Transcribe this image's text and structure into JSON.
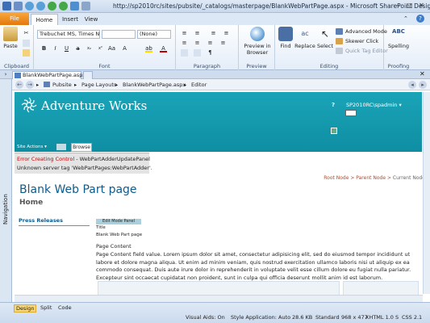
{
  "window": {
    "title": "http://sp2010rc/sites/pubsite/_catalogs/masterpage/BlankWebPartPage.aspx - Microsoft SharePoint Designer",
    "controls": [
      "–",
      "□",
      "✕"
    ]
  },
  "ribbon": {
    "tabs": {
      "file": "File",
      "home": "Home",
      "insert": "Insert",
      "view": "View"
    },
    "clipboard": {
      "label": "Clipboard",
      "paste": "Paste"
    },
    "font": {
      "label": "Font",
      "family": "Trebuchet MS, Times Ne",
      "size": "",
      "style": "(None)"
    },
    "paragraph": {
      "label": "Paragraph"
    },
    "preview": {
      "label": "Preview",
      "preview_in_browser": "Preview in Browser"
    },
    "editing": {
      "label": "Editing",
      "find": "Find",
      "replace": "Replace",
      "select": "Select",
      "advanced_mode": "Advanced Mode",
      "skewer_click": "Skewer Click",
      "quick_tag_editor": "Quick Tag Editor"
    },
    "proofing": {
      "label": "Proofing",
      "spelling": "Spelling"
    }
  },
  "document": {
    "tab_label": "BlankWebPartPage.aspx",
    "navigation_label": "Navigation",
    "breadcrumb": [
      "Pubsite",
      "Page Layouts",
      "BlankWebPartPage.aspx",
      "Editor"
    ]
  },
  "page": {
    "site_title": "Adventure Works",
    "user": "SP2010RC\\spadmin",
    "help": "?",
    "site_actions": "Site Actions",
    "browse_tab": "Browse",
    "error_title": "Error Creating Control",
    "error_title_rest": " - WebPartAdderUpdatePanel",
    "error_message": "Unknown server tag 'WebPartPages:WebPartAdder'.",
    "crumbs": {
      "root": "Root Node",
      "parent": "Parent Node",
      "current": "Current Node",
      "sep": " > "
    },
    "title": "Blank Web Part page",
    "subtitle": "Home",
    "press_releases": "Press Releases",
    "edit_mode_panel": "Edit Mode Panel",
    "title_label": "Title",
    "title_value": "Blank Web Part page",
    "page_content_label": "Page Content",
    "page_content_body": "Page Content field value. Lorem ipsum dolor sit amet, consectetur adipisicing elit, sed do eiusmod tempor incididunt ut labore et dolore magna aliqua. Ut enim ad minim veniam, quis nostrud exercitation ullamco laboris nisi ut aliquip ex ea commodo consequat. Duis aute irure dolor in reprehenderit in voluptate velit esse cillum dolore eu fugiat nulla pariatur. Excepteur sint occaecat cupidatat non proident, sunt in culpa qui officia deserunt mollit anim id est laborum."
  },
  "status": {
    "views": {
      "design": "Design",
      "split": "Split",
      "code": "Code"
    },
    "visual_aids": "Visual Aids: On",
    "style_application": "Style Application: Auto",
    "size": "28.6 KB",
    "mode": "Standard",
    "dimensions": "968 x 477",
    "doctype": "XHTML 1.0 S",
    "css": "CSS 2.1"
  },
  "colors": {
    "accent_teal": "#1aa4b8",
    "file_tab": "#e3770e",
    "error_red": "#c00000"
  }
}
